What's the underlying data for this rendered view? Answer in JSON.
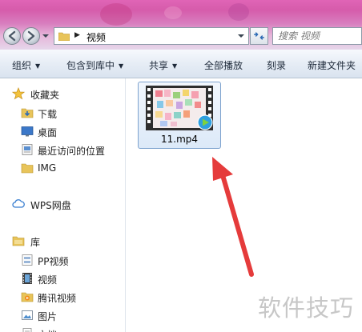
{
  "address_bar": {
    "path": "视频"
  },
  "search": {
    "placeholder": "搜索 视频"
  },
  "toolbar": {
    "organize": "组织",
    "include_in_library": "包含到库中",
    "share": "共享",
    "play_all": "全部播放",
    "burn": "刻录",
    "new_folder": "新建文件夹"
  },
  "sidebar": {
    "favorites": "收藏夹",
    "favorites_items": [
      "下载",
      "桌面",
      "最近访问的位置",
      "IMG"
    ],
    "wps": "WPS网盘",
    "libraries": "库",
    "library_items": [
      "PP视频",
      "视频",
      "腾讯视频",
      "图片",
      "文档"
    ]
  },
  "file": {
    "name": "11.mp4",
    "icon": "video-file-icon"
  },
  "watermark": "软件技巧",
  "colors": {
    "title_bar": "#d85fae",
    "selection_border": "#7da2ce",
    "annotation_arrow": "#e53b3b"
  }
}
